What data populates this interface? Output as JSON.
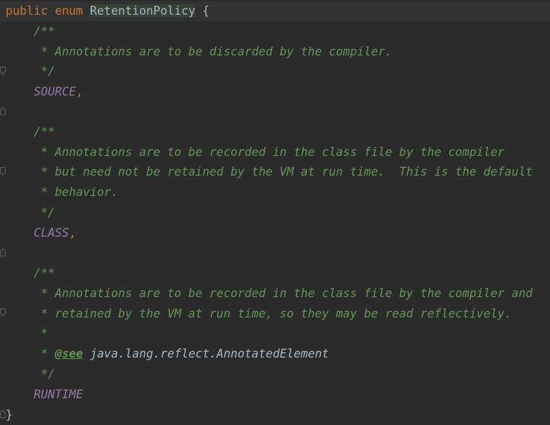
{
  "code": {
    "header": {
      "kw_public": "public",
      "kw_enum": "enum",
      "class_name": "RetentionPolicy",
      "open_brace": "{"
    },
    "source_doc": {
      "open": "/**",
      "body": [
        " * Annotations are to be discarded by the compiler."
      ],
      "close": " */"
    },
    "source_const": "SOURCE",
    "class_doc": {
      "open": "/**",
      "body": [
        " * Annotations are to be recorded in the class file by the compiler",
        " * but need not be retained by the VM at run time.  This is the default",
        " * behavior."
      ],
      "close": " */"
    },
    "class_const": "CLASS",
    "runtime_doc": {
      "open": "/**",
      "body": [
        " * Annotations are to be recorded in the class file by the compiler and",
        " * retained by the VM at run time, so they may be read reflectively.",
        " *"
      ],
      "see_prefix": " * ",
      "see_tag": "@see",
      "see_ref": "java.lang.reflect.AnnotatedElement",
      "close": " */"
    },
    "runtime_const": "RUNTIME",
    "comma": ",",
    "close_brace": "}"
  },
  "colors": {
    "background": "#2b2b2b",
    "keyword": "#cc7832",
    "comment": "#629755",
    "constant": "#9876aa",
    "text": "#a9b7c6"
  },
  "icons": {
    "fold_open": "fold-open-icon",
    "fold_close": "fold-close-icon"
  }
}
